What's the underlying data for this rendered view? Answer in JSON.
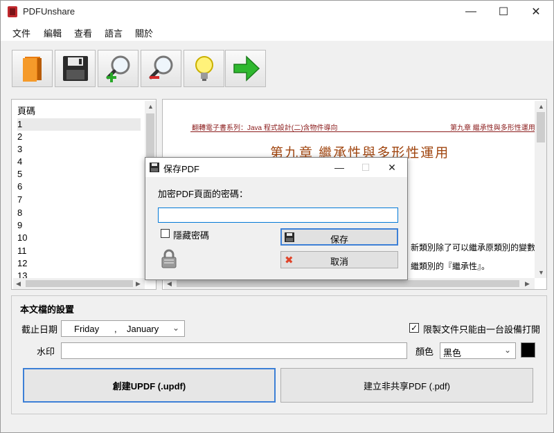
{
  "window": {
    "title": "PDFUnshare"
  },
  "menu": [
    "文件",
    "編輯",
    "查看",
    "語言",
    "關於"
  ],
  "toolbar": {
    "icons": [
      "book-icon",
      "floppy-disk-icon",
      "zoom-in-icon",
      "zoom-out-icon",
      "lightbulb-icon",
      "arrow-right-icon"
    ]
  },
  "page_list": {
    "header": "頁碼",
    "items": [
      "1",
      "2",
      "3",
      "4",
      "5",
      "6",
      "7",
      "8",
      "9",
      "10",
      "11",
      "12",
      "13"
    ],
    "selected": "1"
  },
  "preview": {
    "header_left": "翻轉電子書系列：Java 程式設計(二)含物件導向",
    "header_right": "第九章 繼承性與多形性運用",
    "chapter_title": "第九章 繼承性與多形性運用",
    "line1": "新類別除了可以繼承原類別的變數",
    "line2": "繼類別的『繼承性』。"
  },
  "settings": {
    "title": "本文檔的設置",
    "expiry_label": "截止日期",
    "expiry_weekday": "Friday",
    "expiry_separator": ",",
    "expiry_month": "January",
    "one_device_label": "限製文件只能由一台設備打開",
    "one_device_checked": true,
    "watermark_label": "水印",
    "watermark_value": "",
    "color_label": "顏色",
    "color_value": "黑色",
    "color_hex": "#000000",
    "create_updf_label": "創建UPDF (.updf)",
    "create_pdf_label": "建立非共享PDF (.pdf)"
  },
  "dialog": {
    "title": "保存PDF",
    "prompt": "加密PDF頁面的密碼：",
    "password_value": "",
    "hide_password_label": "隱藏密碼",
    "hide_password_checked": false,
    "save_label": "保存",
    "cancel_label": "取消"
  },
  "colors": {
    "accent": "#0078d7",
    "header_red": "#8a1a1a",
    "chapter_orange": "#a0450f"
  }
}
